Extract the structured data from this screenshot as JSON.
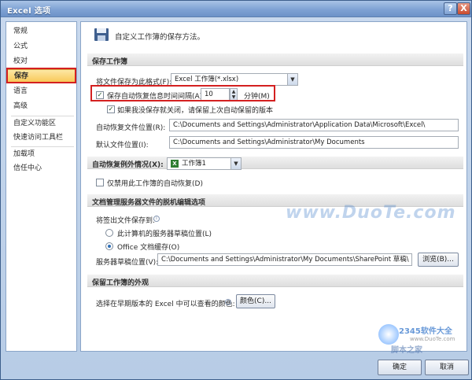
{
  "window": {
    "title": "Excel 选项",
    "help_glyph": "?",
    "close_glyph": "X"
  },
  "sidebar": {
    "items": [
      {
        "label": "常规"
      },
      {
        "label": "公式"
      },
      {
        "label": "校对"
      },
      {
        "label": "保存",
        "selected": true
      },
      {
        "label": "语言"
      },
      {
        "label": "高级"
      },
      {
        "label": "自定义功能区"
      },
      {
        "label": "快速访问工具栏"
      },
      {
        "label": "加载项"
      },
      {
        "label": "信任中心"
      }
    ]
  },
  "main": {
    "header": "自定义工作簿的保存方法。",
    "save_section": {
      "title": "保存工作簿",
      "format_label": "将文件保存为此格式(F):",
      "format_value": "Excel 工作簿(*.xlsx)",
      "autorecover_label": "保存自动恢复信息时间间隔(A)",
      "autorecover_checked": true,
      "autorecover_minutes": "10",
      "minutes_label": "分钟(M)",
      "keep_last_label": "如果我没保存就关闭，请保留上次自动保留的版本",
      "keep_last_checked": true,
      "autorecover_location_label": "自动恢复文件位置(R):",
      "autorecover_location_value": "C:\\Documents and Settings\\Administrator\\Application Data\\Microsoft\\Excel\\",
      "default_location_label": "默认文件位置(I):",
      "default_location_value": "C:\\Documents and Settings\\Administrator\\My Documents"
    },
    "exceptions": {
      "label": "自动恢复例外情况(X):",
      "workbook": "工作簿1",
      "disable_label": "仅禁用此工作簿的自动恢复(D)",
      "disable_checked": false
    },
    "offline_section": {
      "title": "文档管理服务器文件的脱机编辑选项",
      "save_checked_out_label": "将签出文件保存到:",
      "option_server": "此计算机的服务器草稿位置(L)",
      "option_office": "Office 文档缓存(O)",
      "selected_option": "office",
      "drafts_label": "服务器草稿位置(V):",
      "drafts_value": "C:\\Documents and Settings\\Administrator\\My Documents\\SharePoint 草稿\\",
      "browse_label": "浏览(B)..."
    },
    "appearance_section": {
      "title": "保留工作簿的外观",
      "colors_label": "选择在早期版本的 Excel 中可以查看的颜色:",
      "colors_button": "颜色(C)..."
    }
  },
  "watermark": {
    "site": "www.DuoTe.com",
    "brand": "2345软件大全",
    "url": "www.DuoTe.com",
    "cn": "脚本之家"
  },
  "footer": {
    "ok_label": "确定",
    "cancel_label": "取消"
  },
  "colors": {
    "highlight_red": "#d42020",
    "selected_item_bg": "#f8c959"
  }
}
